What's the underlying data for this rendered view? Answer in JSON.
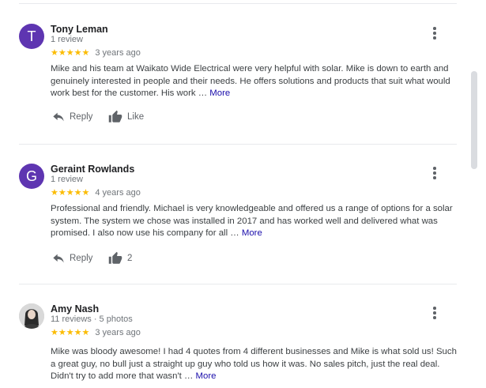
{
  "reviews": [
    {
      "initial": "T",
      "name": "Tony Leman",
      "meta": "1 review",
      "stars": "★★★★★",
      "time": "3 years ago",
      "text": "Mike and his team at Waikato Wide Electrical were very helpful with solar. Mike is down to earth and genuinely interested in people and their needs. He offers solutions and products that suit what would work best for the customer. His work … ",
      "more": "More",
      "reply_label": "Reply",
      "like_label": "Like"
    },
    {
      "initial": "G",
      "name": "Geraint Rowlands",
      "meta": "1 review",
      "stars": "★★★★★",
      "time": "4 years ago",
      "text": "Professional and friendly. Michael is very knowledgeable and offered us a range of options for a solar system. The system we chose was installed in 2017 and has worked well and delivered what was promised. I also now use his company for all … ",
      "more": "More",
      "reply_label": "Reply",
      "like_label": "2"
    },
    {
      "name": "Amy Nash",
      "meta": "11 reviews · 5 photos",
      "stars": "★★★★★",
      "time": "3 years ago",
      "text": "Mike was bloody awesome! I had 4 quotes from 4 different businesses and Mike is what sold us! Such a great guy, no bull just a straight up guy who told us how it was. No sales pitch, just the real deal. Didn't try to add more that wasn't … ",
      "more": "More"
    }
  ],
  "colors": {
    "avatar": "#5e35b1",
    "stars": "#fbbc04",
    "more_link": "#1a0dab"
  }
}
